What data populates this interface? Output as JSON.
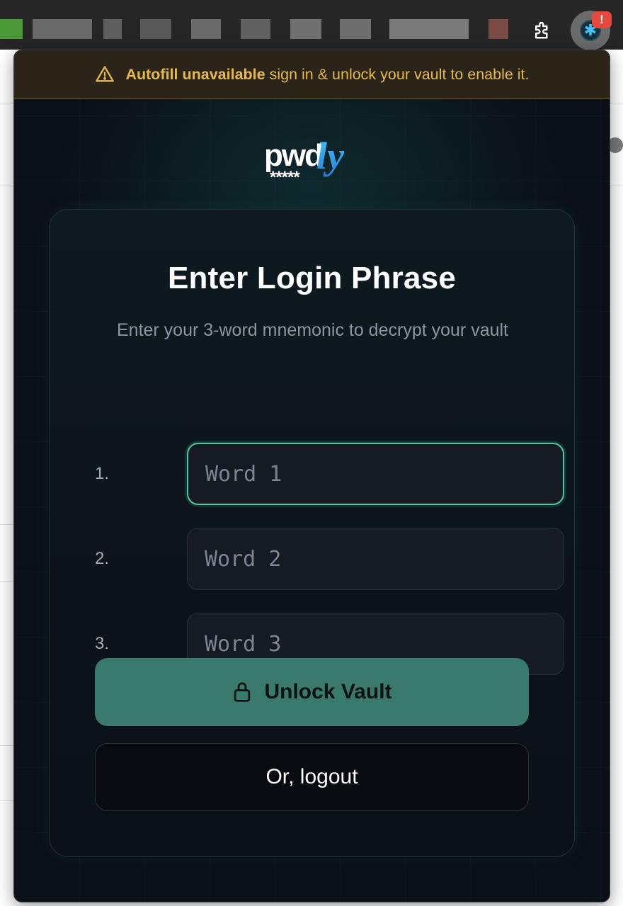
{
  "browser": {
    "extension_badge": "!"
  },
  "banner": {
    "title": "Autofill unavailable",
    "message": "sign in & unlock your vault to enable it."
  },
  "logo": {
    "text_main": "pwd",
    "text_accent": "ly",
    "stars": "*****"
  },
  "card": {
    "title": "Enter Login Phrase",
    "subtitle": "Enter your 3-word mnemonic to decrypt your vault"
  },
  "words": [
    {
      "number": "1.",
      "placeholder": "Word 1"
    },
    {
      "number": "2.",
      "placeholder": "Word 2"
    },
    {
      "number": "3.",
      "placeholder": "Word 3"
    }
  ],
  "actions": {
    "unlock_label": "Unlock Vault",
    "logout_label": "Or, logout"
  },
  "colors": {
    "accent": "#397a6c",
    "focus": "#4fc7a6",
    "warning": "#e7b84a",
    "logo_blue": "#3aa3e6"
  }
}
